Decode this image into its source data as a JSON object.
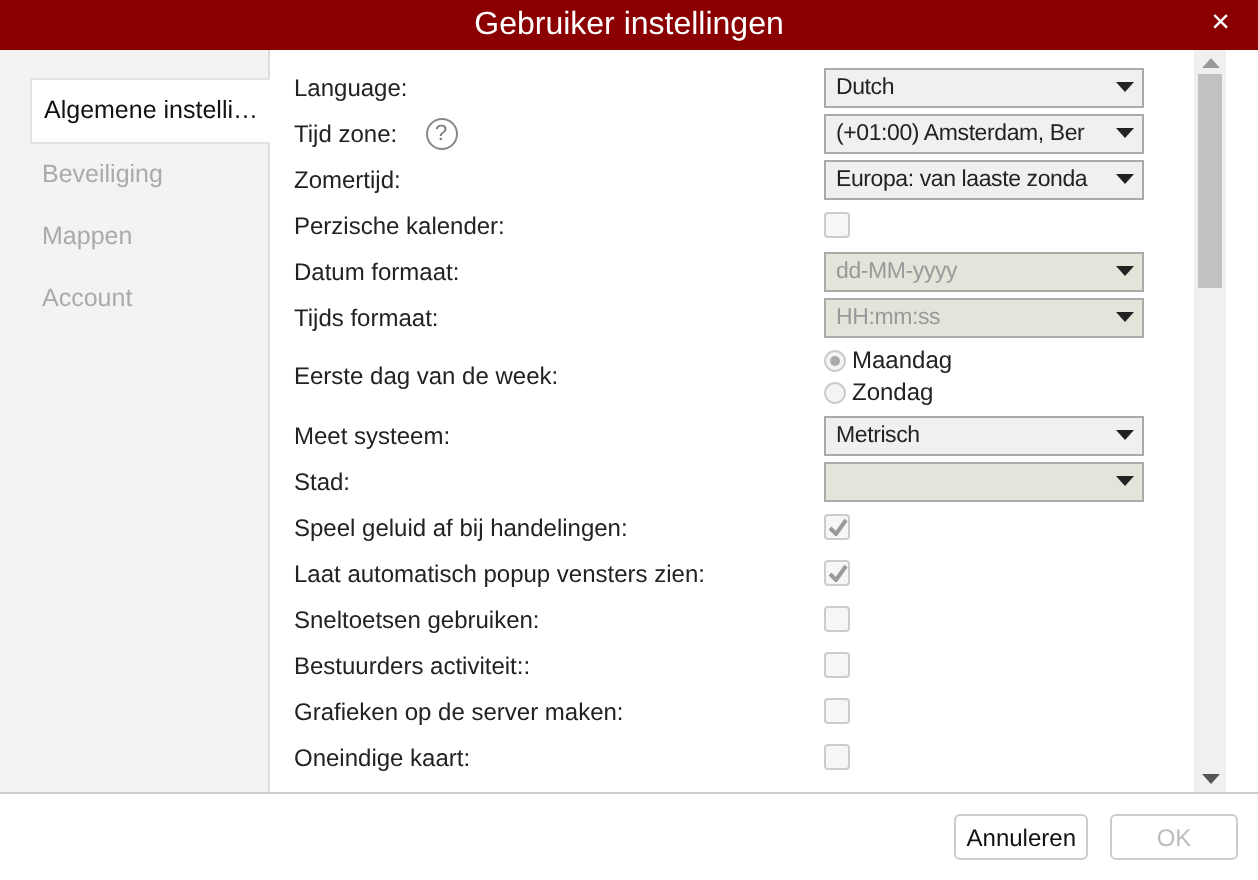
{
  "window": {
    "title": "Gebruiker instellingen",
    "close": "×"
  },
  "sidebar": {
    "items": [
      {
        "label": "Algemene instelli…",
        "selected": true
      },
      {
        "label": "Beveiliging",
        "selected": false
      },
      {
        "label": "Mappen",
        "selected": false
      },
      {
        "label": "Account",
        "selected": false
      }
    ]
  },
  "settings": [
    {
      "kind": "select",
      "label": "Language:",
      "value": "Dutch",
      "disabled": false
    },
    {
      "kind": "select",
      "label": "Tijd zone:",
      "value": "(+01:00) Amsterdam, Ber",
      "disabled": false,
      "help_text": "?"
    },
    {
      "kind": "select",
      "label": "Zomertijd:",
      "value": "Europa: van laaste zonda",
      "disabled": false
    },
    {
      "kind": "checkbox",
      "label": "Perzische kalender:",
      "checked": false
    },
    {
      "kind": "select",
      "label": "Datum formaat:",
      "value": "dd-MM-yyyy",
      "disabled": true
    },
    {
      "kind": "select",
      "label": "Tijds formaat:",
      "value": "HH:mm:ss",
      "disabled": true
    },
    {
      "kind": "radio",
      "label": "Eerste dag van de week:",
      "options": [
        {
          "label": "Maandag",
          "selected": true
        },
        {
          "label": "Zondag",
          "selected": false
        }
      ]
    },
    {
      "kind": "select",
      "label": "Meet systeem:",
      "value": "Metrisch",
      "disabled": false
    },
    {
      "kind": "select",
      "label": "Stad:",
      "disabled": true
    },
    {
      "kind": "checkbox",
      "label": "Speel geluid af bij handelingen:",
      "checked": true
    },
    {
      "kind": "checkbox",
      "label": "Laat automatisch popup vensters zien:",
      "checked": true
    },
    {
      "kind": "checkbox",
      "label": "Sneltoetsen gebruiken:",
      "checked": false
    },
    {
      "kind": "checkbox",
      "label": "Bestuurders activiteit::",
      "checked": false
    },
    {
      "kind": "checkbox",
      "label": "Grafieken op de server maken:",
      "checked": false
    },
    {
      "kind": "checkbox",
      "label": "Oneindige kaart:",
      "checked": false
    }
  ],
  "buttons": [
    {
      "label": "Annuleren",
      "disabled": false
    },
    {
      "label": "OK",
      "disabled": true
    }
  ]
}
